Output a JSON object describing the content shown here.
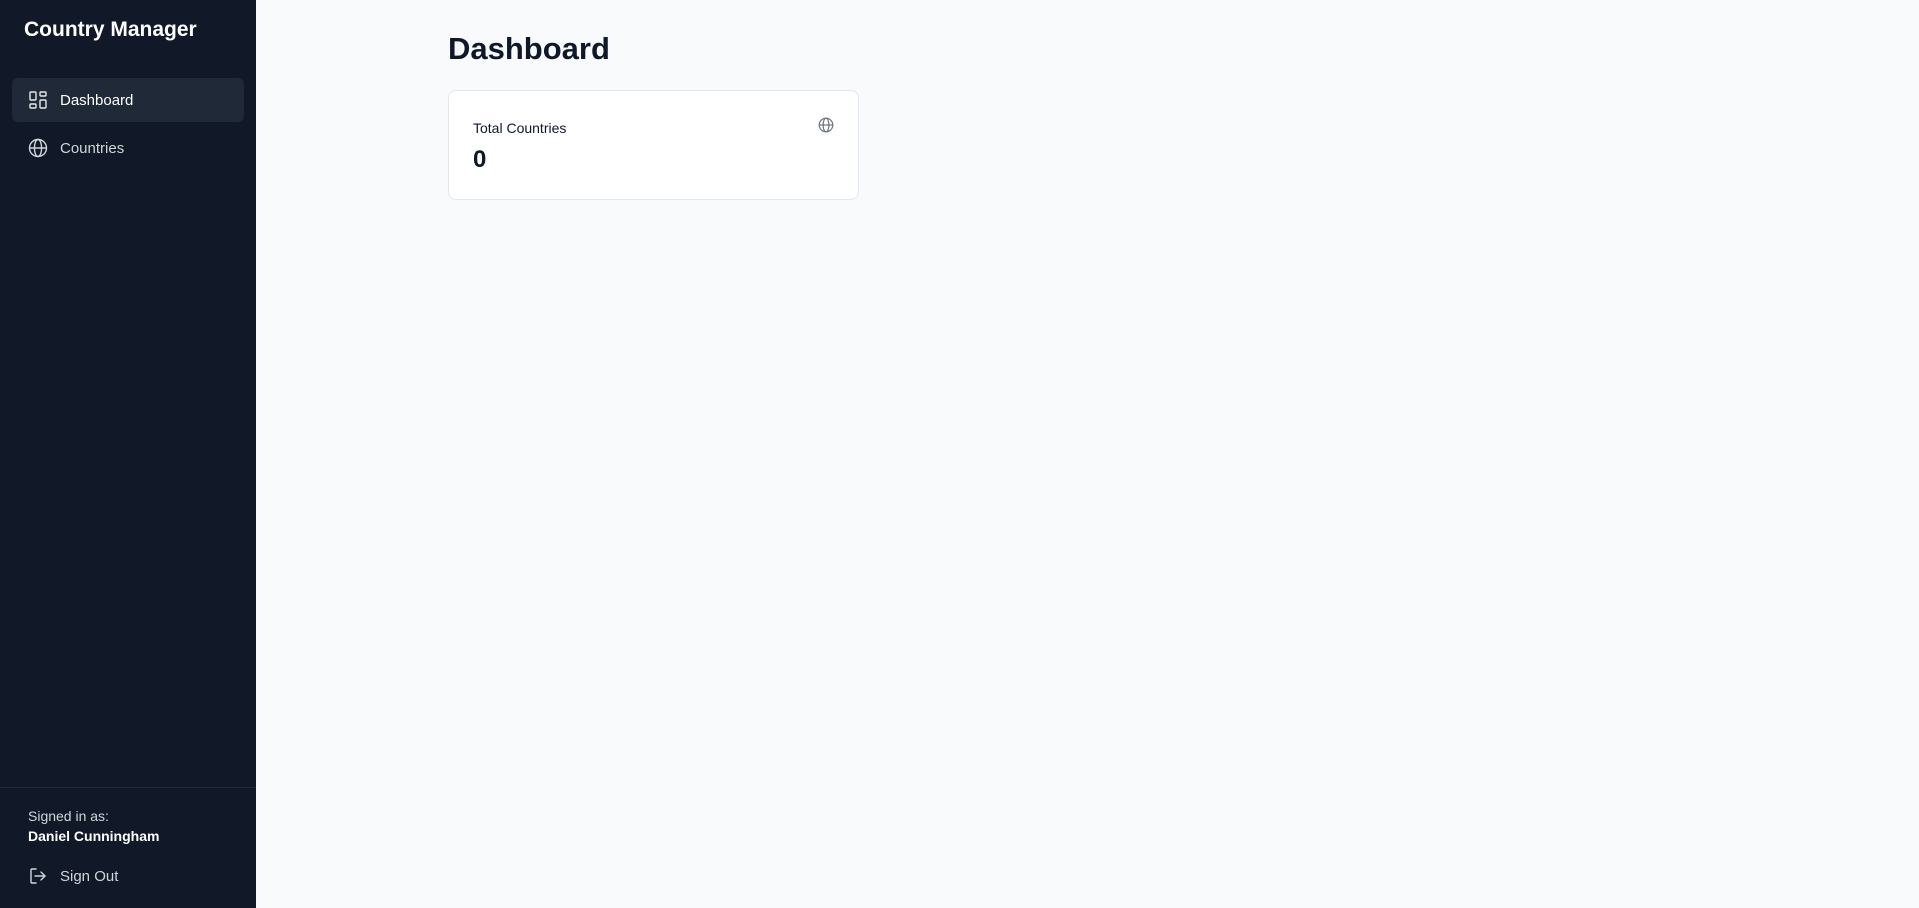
{
  "app": {
    "title": "Country Manager"
  },
  "sidebar": {
    "items": [
      {
        "label": "Dashboard",
        "icon": "dashboard-icon",
        "active": true
      },
      {
        "label": "Countries",
        "icon": "globe-icon",
        "active": false
      }
    ],
    "footer": {
      "signed_label": "Signed in as:",
      "user_name": "Daniel Cunningham",
      "signout_label": "Sign Out",
      "signout_icon": "logout-icon"
    }
  },
  "main": {
    "title": "Dashboard",
    "cards": [
      {
        "label": "Total Countries",
        "value": "0",
        "icon": "globe-icon"
      }
    ]
  },
  "colors": {
    "sidebar_bg": "#111827",
    "sidebar_active_bg": "#1f2937",
    "main_bg": "#f8fafc",
    "card_border": "#e2e8f0"
  }
}
